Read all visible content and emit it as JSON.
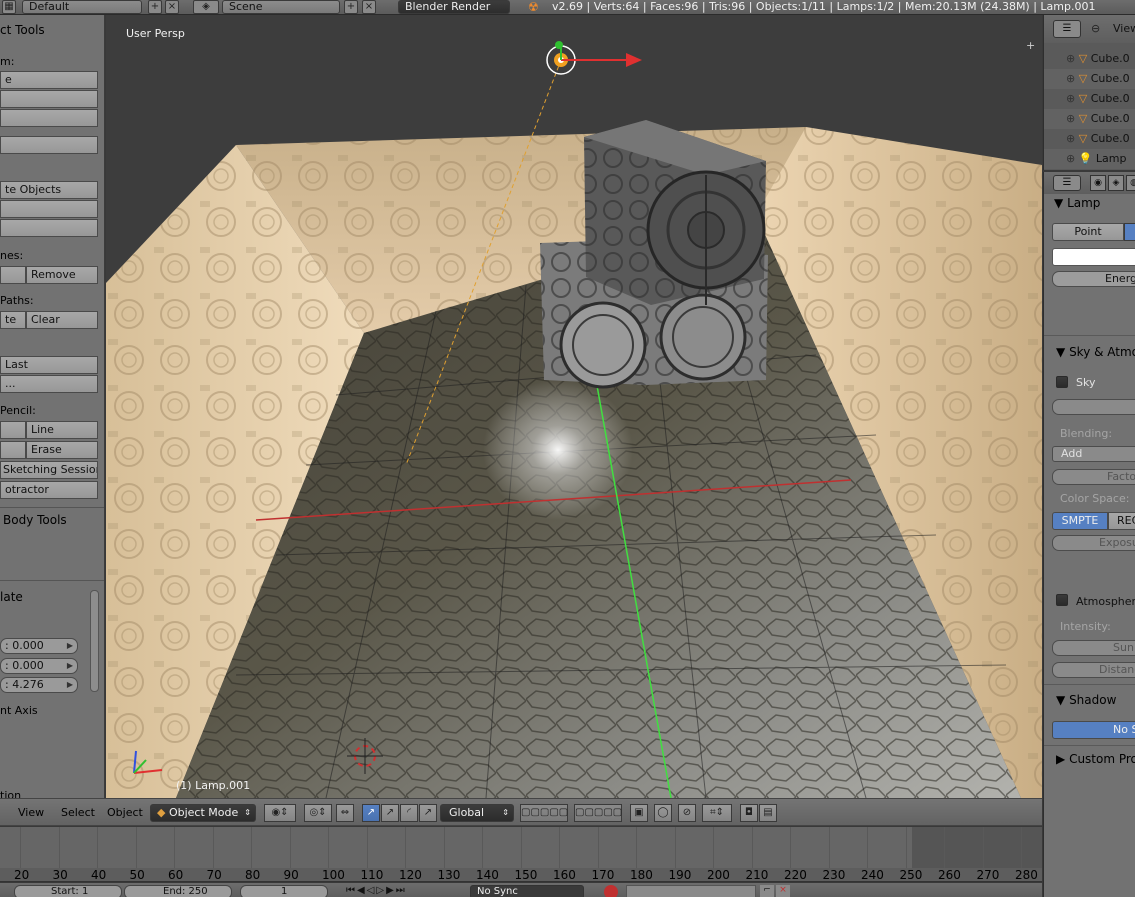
{
  "topbar": {
    "layout": "Default",
    "scene": "Scene",
    "engine": "Blender Render",
    "stats": "v2.69 | Verts:64 | Faces:96 | Tris:96 | Objects:1/11 | Lamps:1/2 | Mem:20.13M (24.38M) | Lamp.001",
    "view_label": "View"
  },
  "shelf": {
    "title": "ct Tools",
    "transform_label": "m:",
    "rows": [
      "e",
      "",
      "",
      ""
    ],
    "objects_btn": "te Objects",
    "shading_label": "nes:",
    "remove_btn": "Remove",
    "paths_label": "Paths:",
    "paths_left_btn": "te",
    "clear_btn": "Clear",
    "last_btn": "Last",
    "dots_btn": "...",
    "pencil_label": "Pencil:",
    "line_btn": "Line",
    "erase_btn": "Erase",
    "sketch_btn": "Sketching Sessions",
    "protractor_btn": "otractor",
    "rigid_title": "Body Tools",
    "translate_title": "late",
    "x_val": ": 0.000",
    "y_val": ": 0.000",
    "z_val": ": 4.276",
    "axis_label": "nt Axis",
    "tion_label": "tion"
  },
  "viewport": {
    "persp_label": "User Persp",
    "object_label": "(1) Lamp.001"
  },
  "outliner": {
    "items": [
      {
        "label": "Cube.0",
        "icon": "mesh-icon"
      },
      {
        "label": "Cube.0",
        "icon": "mesh-icon"
      },
      {
        "label": "Cube.0",
        "icon": "mesh-icon"
      },
      {
        "label": "Cube.0",
        "icon": "mesh-icon"
      },
      {
        "label": "Cube.0",
        "icon": "mesh-icon"
      },
      {
        "label": "Lamp",
        "icon": "lamp-icon"
      }
    ]
  },
  "props": {
    "lamp_head": "Lamp",
    "point_btn": "Point",
    "energy_label": "Energy",
    "sky_head": "Sky & Atmos",
    "sky_check": "Sky",
    "blending_label": "Blending:",
    "blend_value": "Add",
    "factor_label": "Facto",
    "color_space_label": "Color Space:",
    "smpte_btn": "SMPTE",
    "rec_btn": "REC",
    "exposure_label": "Exposu",
    "atmosphere_check": "Atmosphere",
    "intensity_label": "Intensity:",
    "sun_label": "Sun:",
    "distance_label": "Distanc",
    "shadow_head": "Shadow",
    "no_shadow_btn": "No S",
    "custom_head": "Custom Prop"
  },
  "vheader": {
    "view": "View",
    "select": "Select",
    "object": "Object",
    "mode": "Object Mode",
    "orientation": "Global"
  },
  "timeline": {
    "ticks": [
      "20",
      "30",
      "40",
      "50",
      "60",
      "70",
      "80",
      "90",
      "100",
      "110",
      "120",
      "130",
      "140",
      "150",
      "160",
      "170",
      "180",
      "190",
      "200",
      "210",
      "220",
      "230",
      "240",
      "250",
      "260",
      "270",
      "280"
    ]
  },
  "bottombar": {
    "start": "Start: 1",
    "end": "End: 250",
    "current": "1",
    "sync": "No Sync"
  },
  "colors": {
    "selection_blue": "#5680c2",
    "x_axis": "#e03030",
    "y_axis": "#40e040",
    "wall": "#e8cfa8",
    "floor": "#5b584a"
  }
}
